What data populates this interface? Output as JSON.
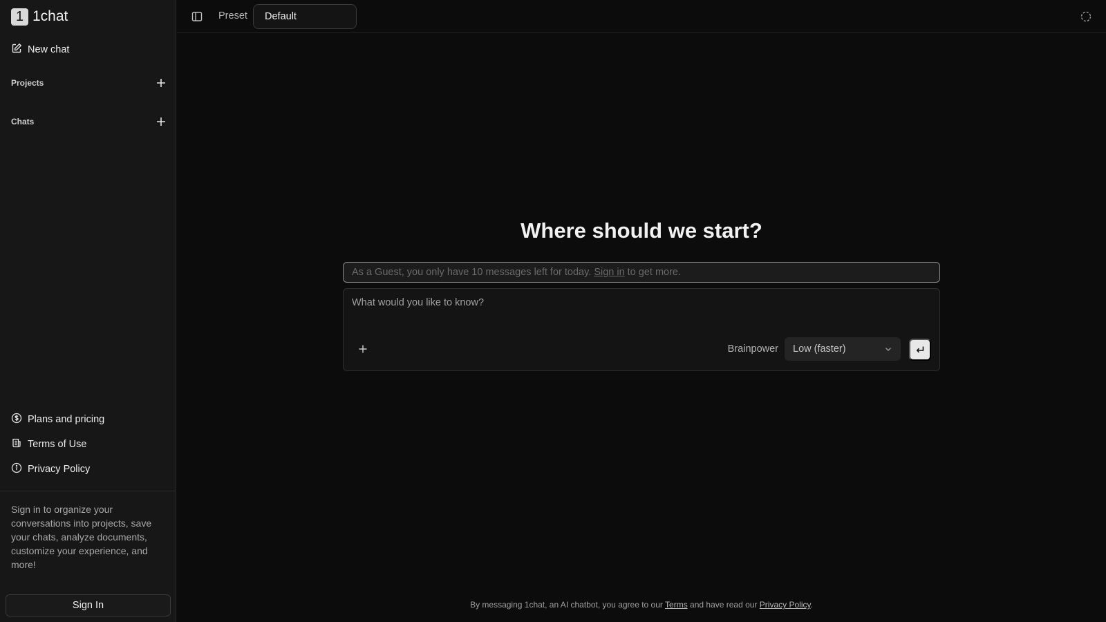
{
  "sidebar": {
    "logo_mark": "1",
    "logo_text": "1chat",
    "new_chat": "New chat",
    "projects_label": "Projects",
    "chats_label": "Chats",
    "bottom_links": [
      {
        "label": "Plans and pricing",
        "icon": "dollar-circle-icon"
      },
      {
        "label": "Terms of Use",
        "icon": "document-icon"
      },
      {
        "label": "Privacy Policy",
        "icon": "info-icon"
      }
    ],
    "signin_note": "Sign in to organize your conversations into projects, save your chats, analyze documents, customize your experience, and more!",
    "signin_button": "Sign In"
  },
  "header": {
    "preset_label": "Preset",
    "preset_value": "Default"
  },
  "main": {
    "title": "Where should we start?",
    "guest_banner": {
      "prefix": "As a Guest, you only have 10 messages left for today.",
      "link": "Sign in",
      "suffix": "to get more."
    },
    "composer": {
      "placeholder": "What would you like to know?",
      "brainpower_label": "Brainpower",
      "brainpower_value": "Low (faster)"
    }
  },
  "footer": {
    "prefix": "By messaging 1chat, an AI chatbot, you agree to our",
    "terms": "Terms",
    "middle": "and have read our",
    "privacy": "Privacy Policy",
    "suffix": "."
  }
}
